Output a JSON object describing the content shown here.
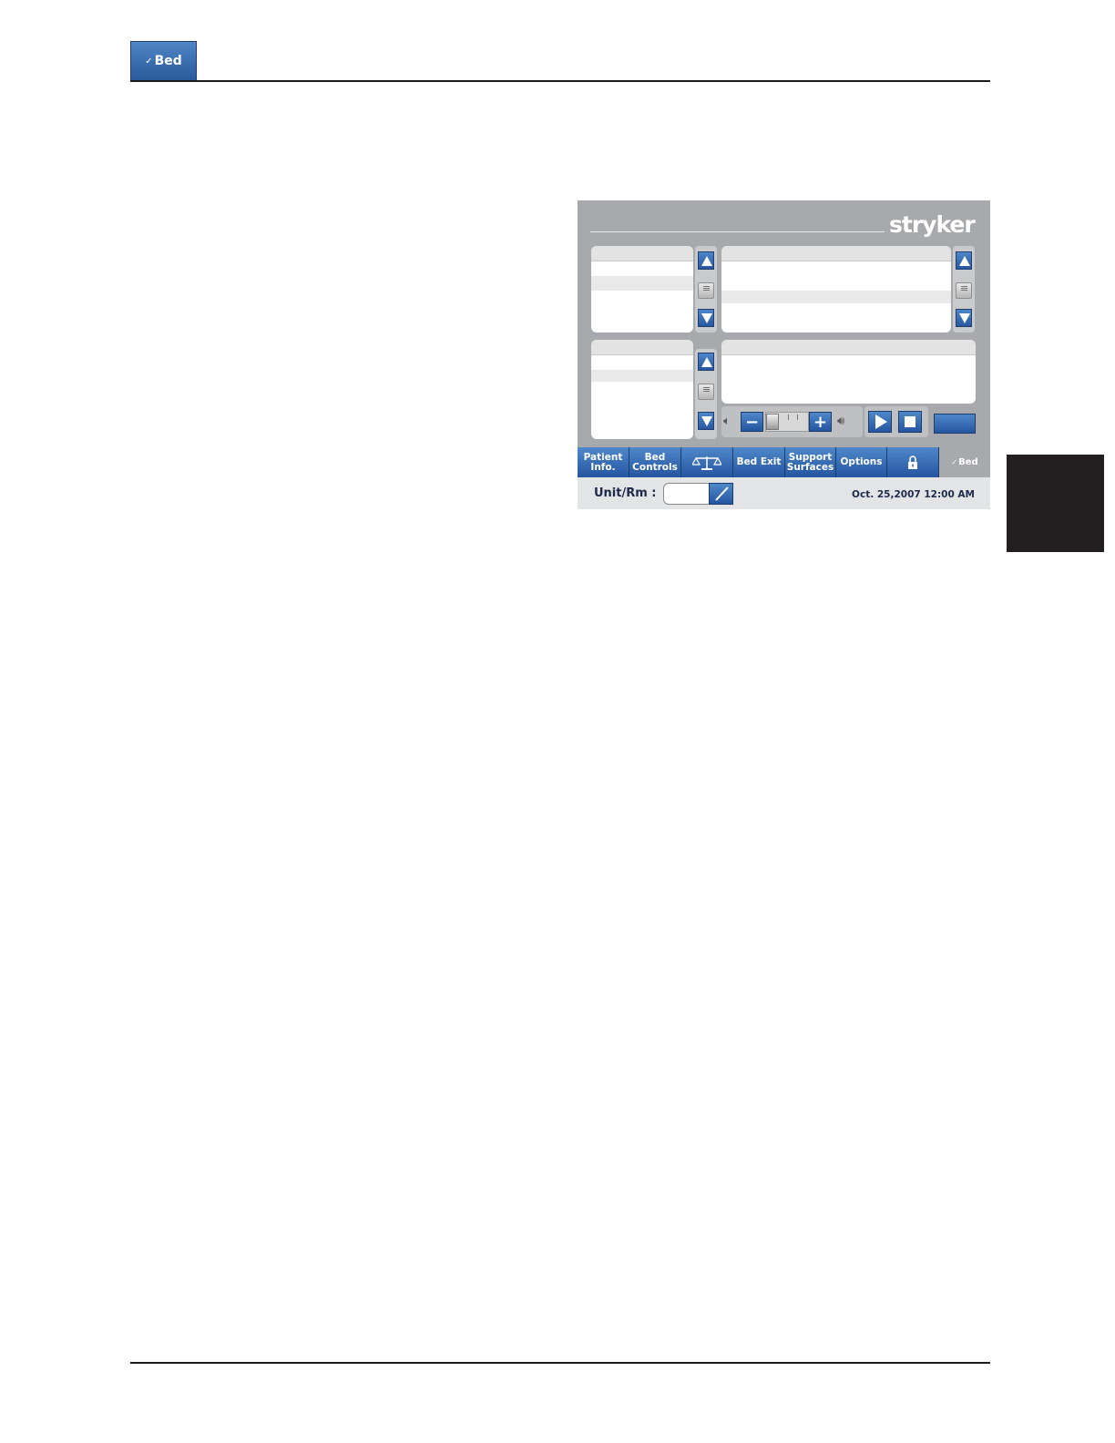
{
  "page": {
    "header_logo": "Bed"
  },
  "screen": {
    "brand": "stryker",
    "nav": {
      "patient_info": "Patient Info.",
      "bed_controls": "Bed Controls",
      "scale_icon": "scale-icon",
      "bed_exit": "Bed Exit",
      "support_surfaces": "Support Surfaces",
      "options": "Options",
      "lock_icon": "lock-icon",
      "logo": "Bed"
    },
    "status": {
      "unit_label": "Unit/Rm :",
      "unit_value": "",
      "datetime": "Oct. 25,2007  12:00 AM"
    },
    "audio": {
      "volume_level": 0.0
    }
  },
  "colors": {
    "accent_blue": "#2f66ae",
    "screen_gray": "#a7a9ac",
    "side_tab": "#231f20"
  }
}
